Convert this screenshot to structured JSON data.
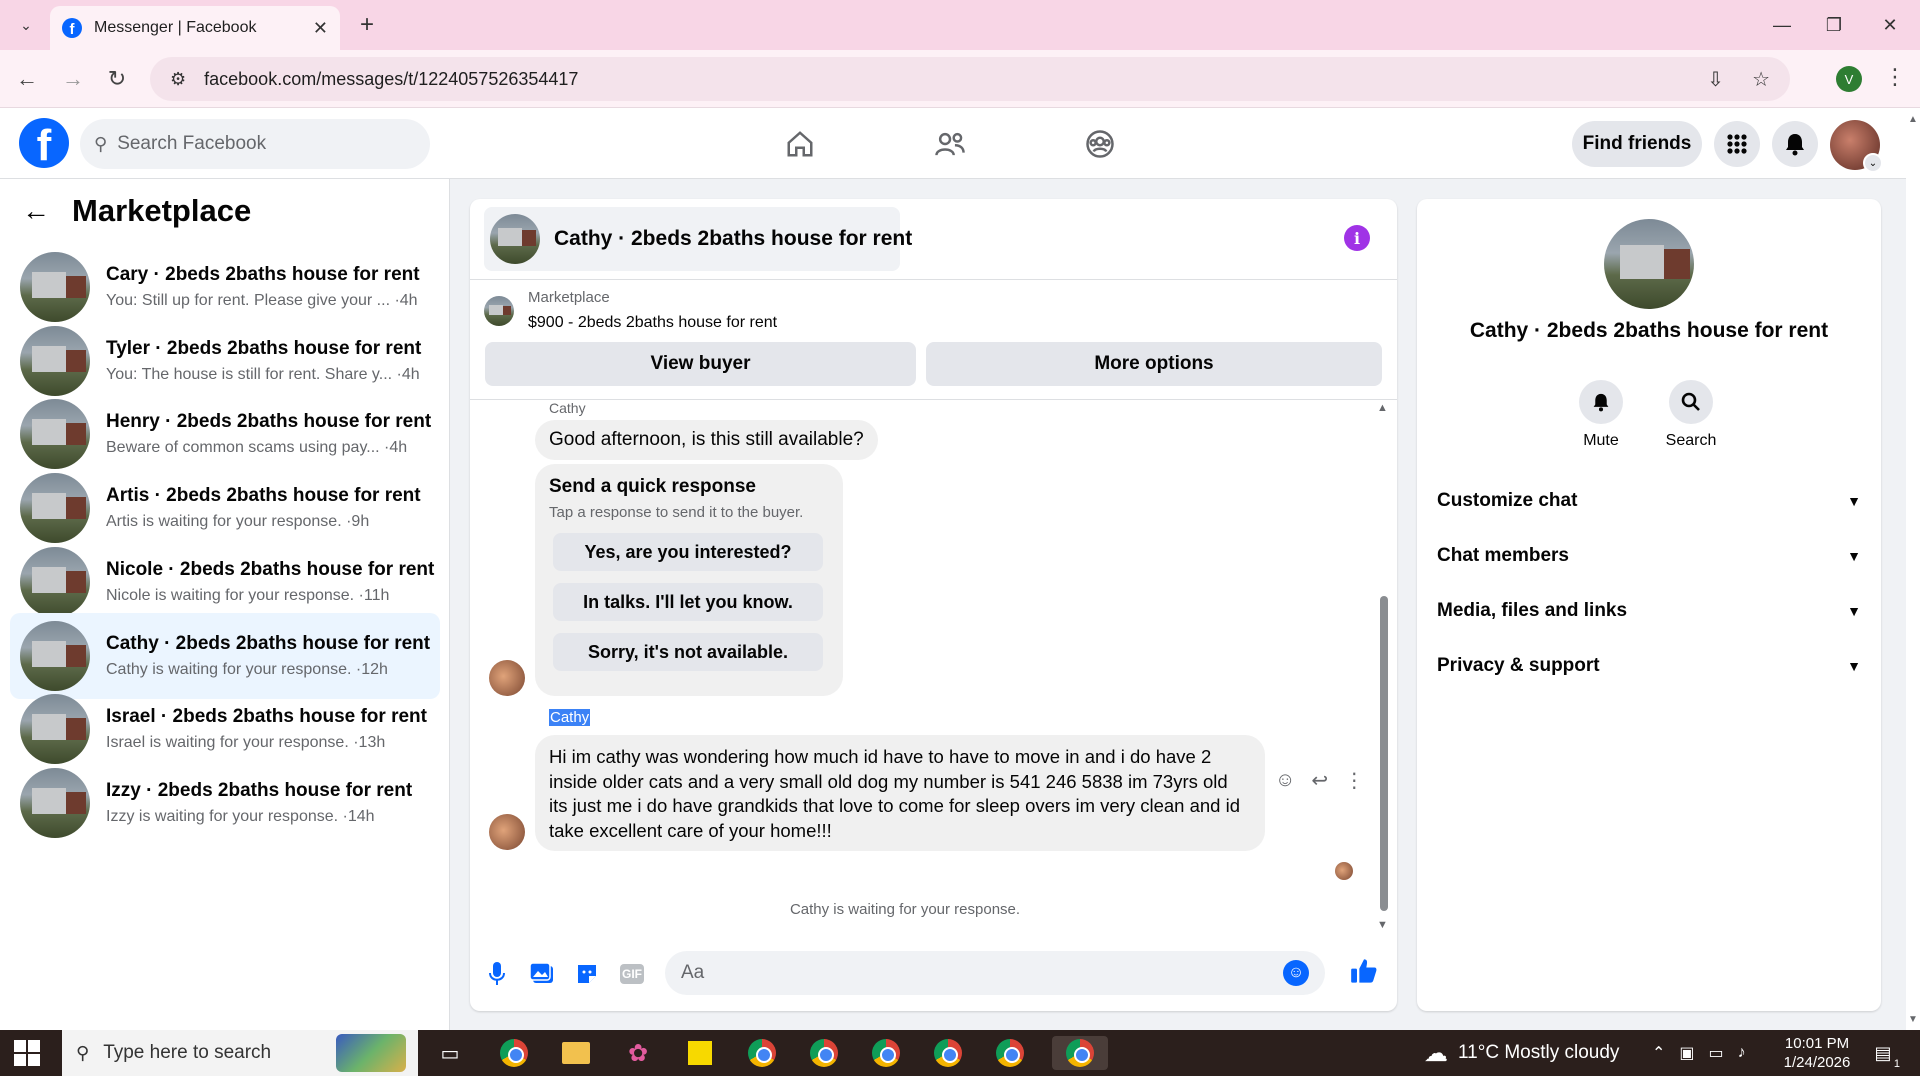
{
  "browser": {
    "tab_title": "Messenger | Facebook",
    "url": "facebook.com/messages/t/1224057526354417",
    "profile_initial": "V"
  },
  "fb": {
    "search_placeholder": "Search Facebook",
    "find_friends": "Find friends",
    "colors": {
      "brand": "#0866ff",
      "active_conv_bg": "#ebf5ff",
      "info_purple": "#a033e6"
    }
  },
  "sidebar": {
    "title": "Marketplace",
    "conversations": [
      {
        "name": "Cary · 2beds 2baths house for rent",
        "preview": "You: Still up for rent. Please give your ... ·4h",
        "active": false
      },
      {
        "name": "Tyler · 2beds 2baths house for rent",
        "preview": "You: The house is still for rent. Share y... ·4h",
        "active": false
      },
      {
        "name": "Henry · 2beds 2baths house for rent",
        "preview": "Beware of common scams using pay... ·4h",
        "active": false
      },
      {
        "name": "Artis · 2beds 2baths house for rent",
        "preview": "Artis is waiting for your response. ·9h",
        "active": false
      },
      {
        "name": "Nicole · 2beds 2baths house for rent",
        "preview": "Nicole is waiting for your response. ·11h",
        "active": false
      },
      {
        "name": "Cathy · 2beds 2baths house for rent",
        "preview": "Cathy is waiting for your response. ·12h",
        "active": true
      },
      {
        "name": "Israel · 2beds 2baths house for rent",
        "preview": "Israel is waiting for your response. ·13h",
        "active": false
      },
      {
        "name": "Izzy · 2beds 2baths house for rent",
        "preview": "Izzy is waiting for your response. ·14h",
        "active": false
      }
    ]
  },
  "chat": {
    "title": "Cathy · 2beds 2baths house for rent",
    "listing_source": "Marketplace",
    "listing_title": "$900 - 2beds 2baths house for rent",
    "view_buyer": "View buyer",
    "more_options": "More options",
    "sender_top": "Cathy",
    "msg1": "Good afternoon, is this still available?",
    "quick_title": "Send a quick response",
    "quick_sub": "Tap a response to send it to the buyer.",
    "quick_options": [
      "Yes, are you interested?",
      "In talks. I'll let you know.",
      "Sorry, it's not available."
    ],
    "sender_second": "Cathy",
    "msg2": "Hi im cathy was wondering how much id have to have to move in and i do have 2 inside older cats and a very small old dog  my number is 541 246 5838 im 73yrs old its just me i do have grandkids that love to come for sleep overs im very clean and id take excellent care of your home!!!",
    "waiting": "Cathy is waiting for your response.",
    "composer_placeholder": "Aa",
    "gif": "GIF"
  },
  "details": {
    "name": "Cathy · 2beds 2baths house for rent",
    "mute": "Mute",
    "search": "Search",
    "rows": [
      "Customize chat",
      "Chat members",
      "Media, files and links",
      "Privacy & support"
    ]
  },
  "taskbar": {
    "search_placeholder": "Type here to search",
    "weather": "11°C  Mostly cloudy",
    "time": "10:01 PM",
    "date": "1/24/2026",
    "notif_count": "1"
  }
}
